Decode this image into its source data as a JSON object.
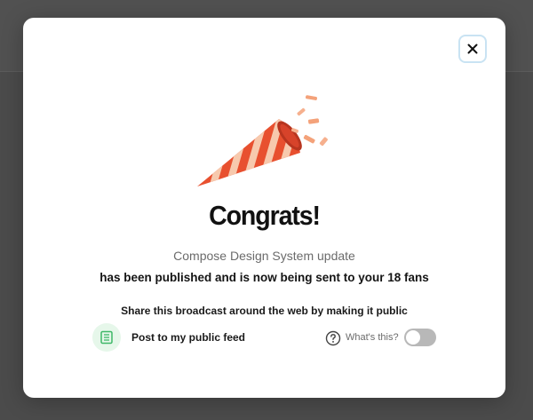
{
  "modal": {
    "title": "Congrats!",
    "broadcast_name": "Compose Design System update",
    "published_message": "has been published and is now being sent to your 18 fans",
    "share_prompt": "Share this broadcast around the web by making it public",
    "close_icon": "close-icon",
    "illustration": "party-popper-icon"
  },
  "public_feed": {
    "label": "Post to my public feed",
    "icon": "document-list-icon",
    "help_label": "What's this?",
    "toggle_on": false
  },
  "colors": {
    "accent_close_border": "#c9e3f3",
    "feed_icon_bg": "#e6f7ea",
    "feed_icon": "#3fb868",
    "toggle_off": "#b8b8b8",
    "popper_red": "#e8502f",
    "popper_stripe": "#f7c9ad"
  }
}
